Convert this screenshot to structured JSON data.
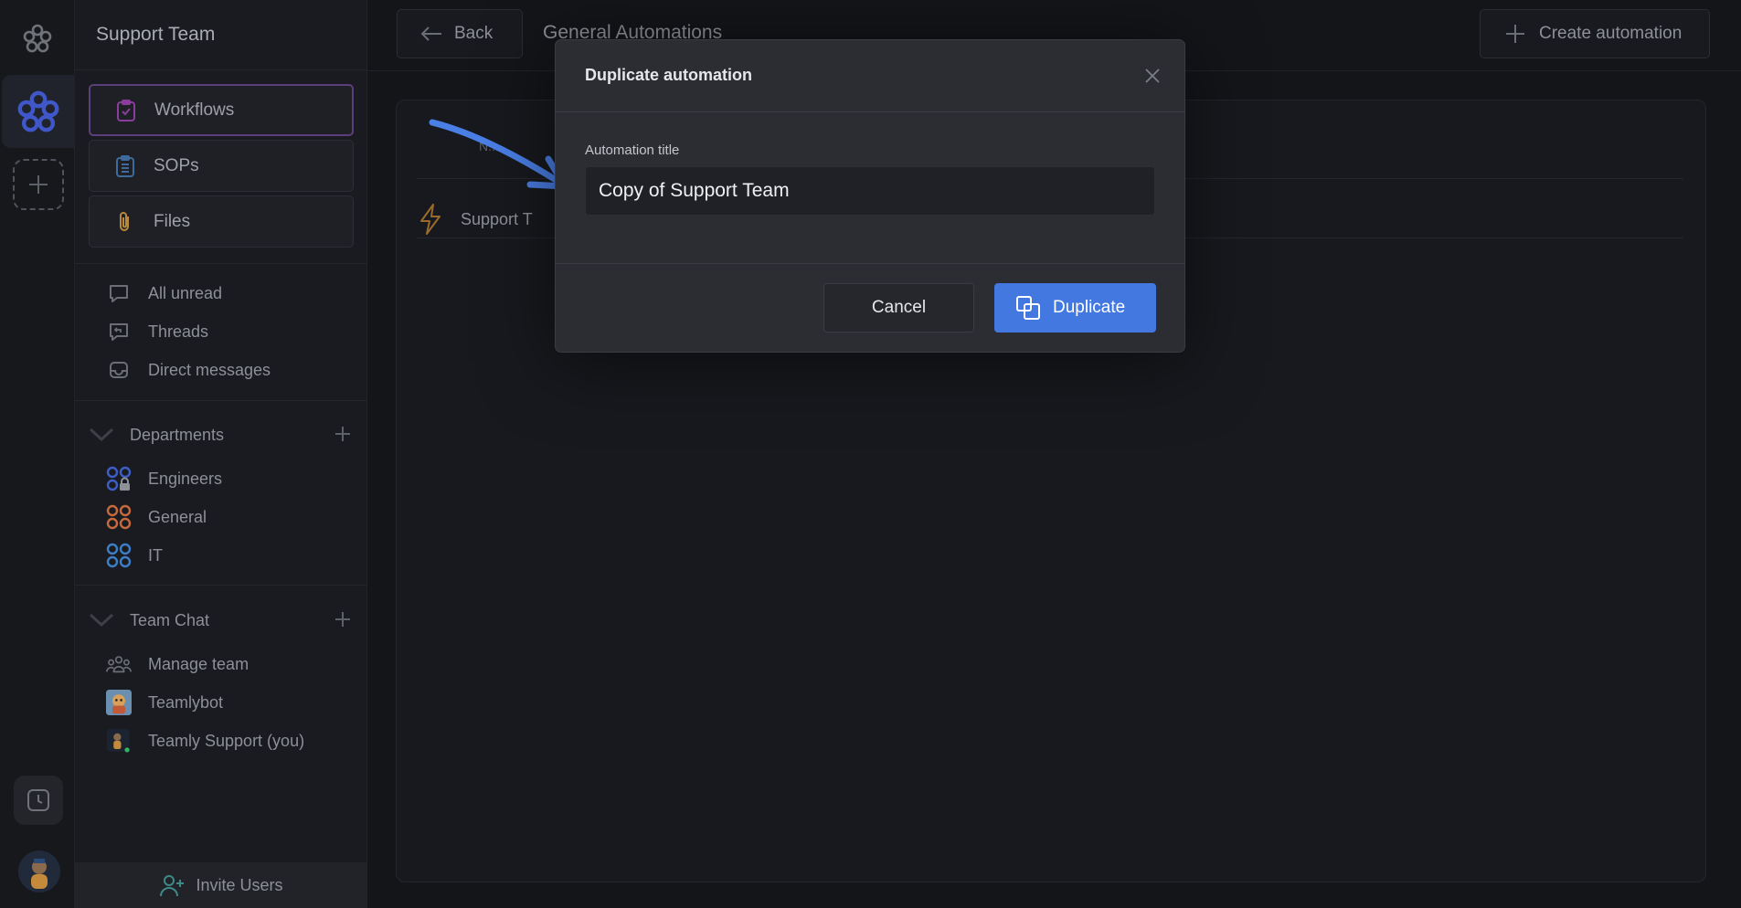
{
  "sidebar": {
    "team_name": "Support Team",
    "nav_cards": [
      {
        "label": "Workflows",
        "icon": "clipboard-check-icon",
        "active": true
      },
      {
        "label": "SOPs",
        "icon": "clipboard-list-icon"
      },
      {
        "label": "Files",
        "icon": "paperclip-icon"
      }
    ],
    "quick_links": [
      {
        "label": "All unread",
        "icon": "chat-bubble-icon"
      },
      {
        "label": "Threads",
        "icon": "reply-icon"
      },
      {
        "label": "Direct messages",
        "icon": "inbox-icon"
      }
    ],
    "departments": {
      "title": "Departments",
      "items": [
        {
          "label": "Engineers",
          "icon": "channel-lock-icon",
          "color": "#3d5ec4"
        },
        {
          "label": "General",
          "icon": "channel-icon",
          "color": "#c46a3d"
        },
        {
          "label": "IT",
          "icon": "channel-icon",
          "color": "#3d7ec4"
        }
      ]
    },
    "team_chat": {
      "title": "Team Chat",
      "items": [
        {
          "label": "Manage team",
          "icon": "people-icon"
        },
        {
          "label": "Teamlybot",
          "icon": "bot-avatar"
        },
        {
          "label": "Teamly Support (you)",
          "icon": "user-avatar"
        }
      ]
    },
    "invite_label": "Invite Users"
  },
  "topbar": {
    "back_label": "Back",
    "title": "General Automations",
    "create_label": "Create automation"
  },
  "table": {
    "header_name": "N...",
    "rows": [
      {
        "name": "Support T",
        "icon": "lightning-icon"
      }
    ]
  },
  "modal": {
    "title": "Duplicate automation",
    "field_label": "Automation title",
    "field_value": "Copy of Support Team",
    "cancel_label": "Cancel",
    "duplicate_label": "Duplicate"
  },
  "colors": {
    "accent": "#4378e0",
    "active_border": "#5b3f7b",
    "annotation_arrow": "#4a7fe6"
  }
}
